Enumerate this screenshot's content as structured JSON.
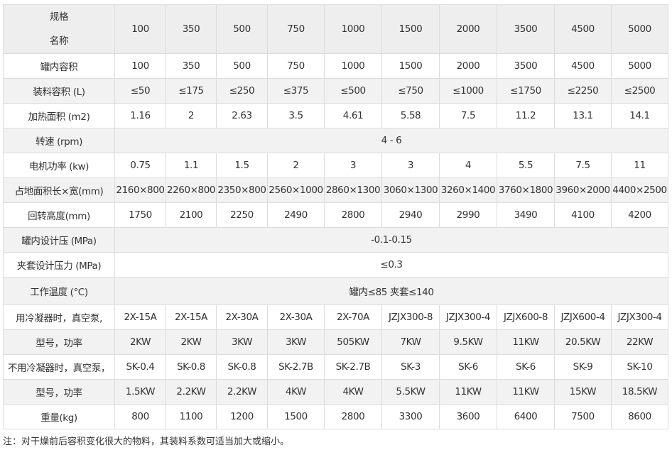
{
  "header": {
    "spec_label": "规格",
    "name_label": "名称",
    "columns": [
      "100",
      "350",
      "500",
      "750",
      "1000",
      "1500",
      "2000",
      "3500",
      "4500",
      "5000"
    ]
  },
  "rows": [
    {
      "label": "罐内容积",
      "values": [
        "100",
        "350",
        "500",
        "750",
        "1000",
        "1500",
        "2000",
        "3500",
        "4500",
        "5000"
      ]
    },
    {
      "label": "装料容积 (L)",
      "values": [
        "≤50",
        "≤175",
        "≤250",
        "≤375",
        "≤500",
        "≤750",
        "≤1000",
        "≤1750",
        "≤2250",
        "≤2500"
      ]
    },
    {
      "label": "加热面积 (m2)",
      "values": [
        "1.16",
        "2",
        "2.63",
        "3.5",
        "4.61",
        "5.58",
        "7.5",
        "11.2",
        "13.1",
        "14.1"
      ]
    },
    {
      "label": "转速 (rpm)",
      "merged": "4 - 6"
    },
    {
      "label": "电机功率 (kw)",
      "values": [
        "0.75",
        "1.1",
        "1.5",
        "2",
        "3",
        "3",
        "4",
        "5.5",
        "7.5",
        "11"
      ]
    },
    {
      "label": "占地面积长×宽(mm)",
      "values": [
        "2160×800",
        "2260×800",
        "2350×800",
        "2560×1000",
        "2860×1300",
        "3060×1300",
        "3260×1400",
        "3760×1800",
        "3960×2000",
        "4400×2500"
      ]
    },
    {
      "label": "回转高度(mm)",
      "values": [
        "1750",
        "2100",
        "2250",
        "2490",
        "2800",
        "2940",
        "2990",
        "3490",
        "4100",
        "4200"
      ]
    },
    {
      "label": "罐内设计压 (MPa)",
      "merged": "-0.1-0.15"
    },
    {
      "label": "夹套设计压力 (MPa)",
      "merged": "≤0.3"
    },
    {
      "label": "工作温度 (°C)",
      "merged": "罐内≤85 夹套≤140"
    },
    {
      "label": "用冷凝器时，真空泵,",
      "values": [
        "2X-15A",
        "2X-15A",
        "2X-30A",
        "2X-30A",
        "2X-70A",
        "JZJX300-8",
        "JZJX300-4",
        "JZJX600-8",
        "JZJX600-4",
        "JZJX300-4"
      ]
    },
    {
      "label": "型号，功率",
      "values": [
        "2KW",
        "2KW",
        "3KW",
        "3KW",
        "505KW",
        "7KW",
        "9.5KW",
        "11KW",
        "20.5KW",
        "22KW"
      ]
    },
    {
      "label": "不用冷凝器时，真空泵，",
      "values": [
        "SK-0.4",
        "SK-0.8",
        "SK-0.8",
        "SK-2.7B",
        "SK-2.7B",
        "SK-3",
        "SK-6",
        "SK-6",
        "SK-9",
        "SK-10"
      ]
    },
    {
      "label": "型号，功率",
      "values": [
        "1.5KW",
        "2.2KW",
        "2.2KW",
        "4KW",
        "4KW",
        "5.5KW",
        "11KW",
        "11KW",
        "15KW",
        "18.5KW"
      ]
    },
    {
      "label": "重量(kg)",
      "values": [
        "800",
        "1100",
        "1200",
        "1500",
        "2800",
        "3300",
        "3600",
        "6400",
        "7500",
        "8600"
      ]
    }
  ],
  "note": "注：对干燥前后容积变化很大的物料，其装料系数可适当加大或缩小。"
}
